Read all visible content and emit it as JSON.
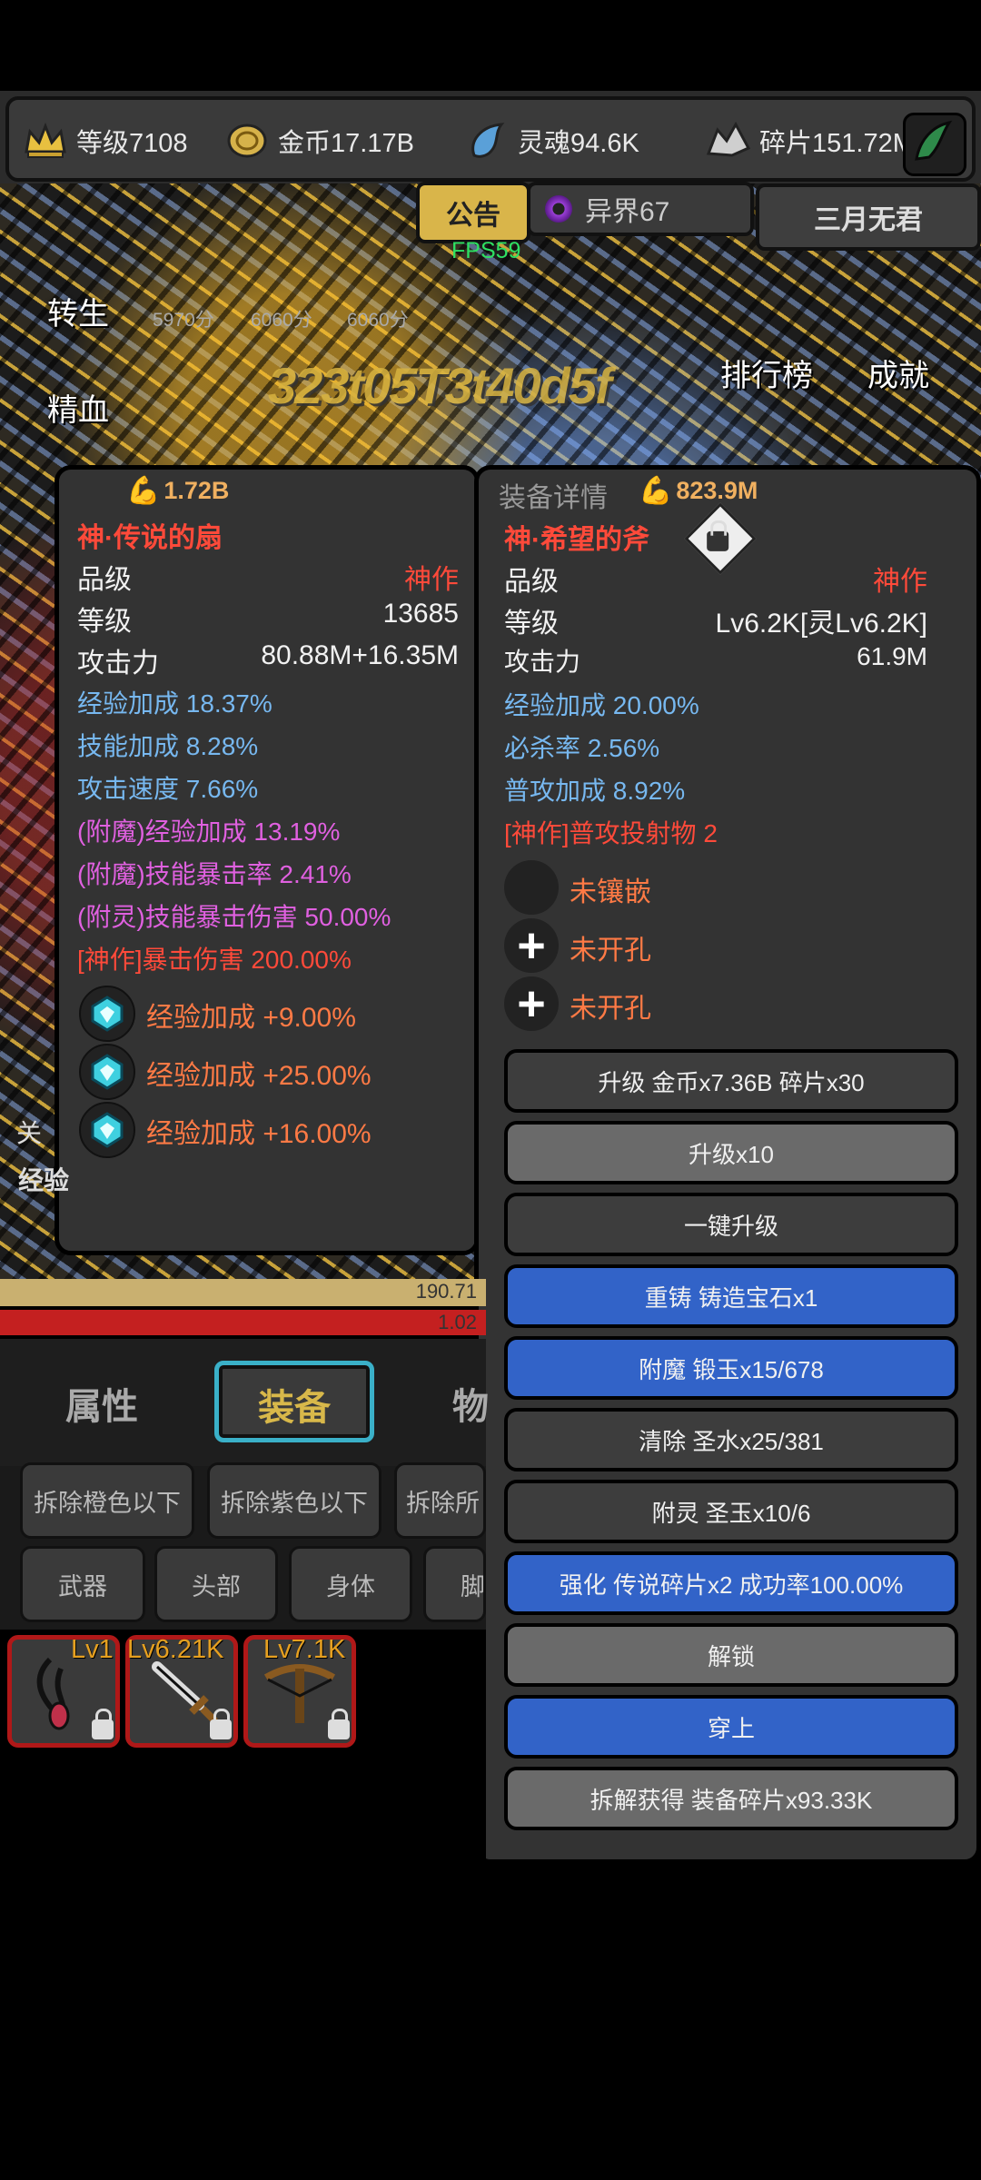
{
  "resources": [
    {
      "icon": "crown-icon",
      "label": "等级7108"
    },
    {
      "icon": "gold-coin-icon",
      "label": "金币17.17B"
    },
    {
      "icon": "soul-icon",
      "label": "灵魂94.6K"
    },
    {
      "icon": "fragment-icon",
      "label": "碎片151.72M"
    }
  ],
  "top_buttons": {
    "notice": "公告",
    "otherworld": "异界67",
    "player_name": "三月无君"
  },
  "fps": "FPS59",
  "scene": {
    "rebirth": "转生",
    "essence": "精血",
    "ranking": "排行榜",
    "achievement": "成就",
    "scores": [
      "5970分",
      "6060分",
      "6060分"
    ],
    "big_text": "323t05T3t40d5f"
  },
  "left_item": {
    "power": "1.72B",
    "name": "神·传说的扇",
    "stats": [
      {
        "label": "品级",
        "value": "神作"
      },
      {
        "label": "等级",
        "value": "13685"
      },
      {
        "label": "攻击力",
        "value": "80.88M+16.35M"
      }
    ],
    "blue_attrs": [
      "经验加成 18.37%",
      "技能加成 8.28%",
      "攻击速度 7.66%"
    ],
    "purple_attrs": [
      "(附魔)经验加成 13.19%",
      "(附魔)技能暴击率 2.41%",
      "(附灵)技能暴击伤害 50.00%"
    ],
    "red_attr": "[神作]暴击伤害 200.00%",
    "gems": [
      "经验加成 +9.00%",
      "经验加成 +25.00%",
      "经验加成 +16.00%"
    ]
  },
  "right_item": {
    "header": "装备详情",
    "power": "823.9M",
    "name": "神·希望的斧",
    "stats": [
      {
        "label": "品级",
        "value": "神作"
      },
      {
        "label": "等级",
        "value": "Lv6.2K[灵Lv6.2K]"
      },
      {
        "label": "攻击力",
        "value": "61.9M"
      }
    ],
    "blue_attrs": [
      "经验加成 20.00%",
      "必杀率 2.56%",
      "普攻加成 8.92%"
    ],
    "red_attr": "[神作]普攻投射物 2",
    "sockets": [
      "未镶嵌",
      "未开孔",
      "未开孔"
    ],
    "buttons": [
      {
        "label": "升级 金币x7.36B 碎片x30",
        "style": "dark"
      },
      {
        "label": "升级x10",
        "style": "grey"
      },
      {
        "label": "一键升级",
        "style": "dark"
      },
      {
        "label": "重铸 铸造宝石x1",
        "style": "blue"
      },
      {
        "label": "附魔 锻玉x15/678",
        "style": "blue"
      },
      {
        "label": "清除 圣水x25/381",
        "style": "dark"
      },
      {
        "label": "附灵 圣玉x10/6",
        "style": "dark"
      },
      {
        "label": "强化 传说碎片x2 成功率100.00%",
        "style": "blue"
      },
      {
        "label": "解锁",
        "style": "grey"
      },
      {
        "label": "穿上",
        "style": "blue"
      },
      {
        "label": "拆解获得 装备碎片x93.33K",
        "style": "grey"
      }
    ]
  },
  "bars": {
    "exp": "190.71",
    "hp": "1.02"
  },
  "bottom": {
    "tabs": [
      "属性",
      "装备",
      "物"
    ],
    "filters": [
      "拆除橙色以下",
      "拆除紫色以下",
      "拆除所"
    ],
    "categories": [
      "武器",
      "头部",
      "身体",
      "脚"
    ],
    "slots": [
      "Lv1",
      "Lv6.21K",
      "Lv7.1K"
    ],
    "left_fragments": [
      "关",
      "经验"
    ]
  },
  "colors": {
    "accent_gold": "#d9b54a",
    "red_text": "#ff4a3a",
    "blue_text": "#77b8f0",
    "purple_text": "#e060e0",
    "blue_button": "#3263c8"
  }
}
